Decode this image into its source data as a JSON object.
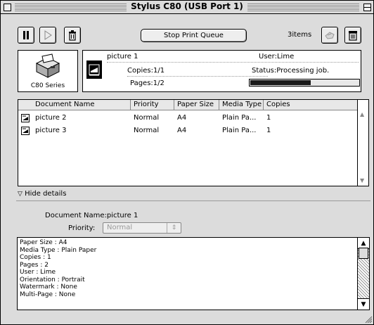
{
  "window": {
    "title": "Stylus C80 (USB Port 1)"
  },
  "toolbar": {
    "stop_label": "Stop Print Queue",
    "items_count": "3items",
    "icons": [
      "pause-icon",
      "play-icon",
      "trash-icon",
      "hand-icon",
      "printer-trash-icon"
    ]
  },
  "printer": {
    "model": "C80 Series"
  },
  "current_job": {
    "name": "picture 1",
    "user": "User:Lime",
    "copies": "Copies:1/1",
    "pages": "Pages:1/2",
    "status": "Status:Processing job.",
    "progress": 0.55
  },
  "table": {
    "headers": [
      "Document Name",
      "Priority",
      "Paper Size",
      "Media Type",
      "Copies"
    ],
    "rows": [
      {
        "name": "picture 2",
        "priority": "Normal",
        "paper": "A4",
        "media": "Plain Pa...",
        "copies": "1"
      },
      {
        "name": "picture 3",
        "priority": "Normal",
        "paper": "A4",
        "media": "Plain Pa...",
        "copies": "1"
      }
    ]
  },
  "details": {
    "toggle_label": "Hide details",
    "doc_name": "Document Name:picture 1",
    "priority_label": "Priority:",
    "priority_value": "Normal",
    "lines": [
      "Paper Size : A4",
      "Media Type : Plain Paper",
      "Copies : 1",
      "Pages : 2",
      "User : Lime",
      "Orientation : Portrait",
      "Watermark : None",
      "Multi-Page : None"
    ]
  }
}
